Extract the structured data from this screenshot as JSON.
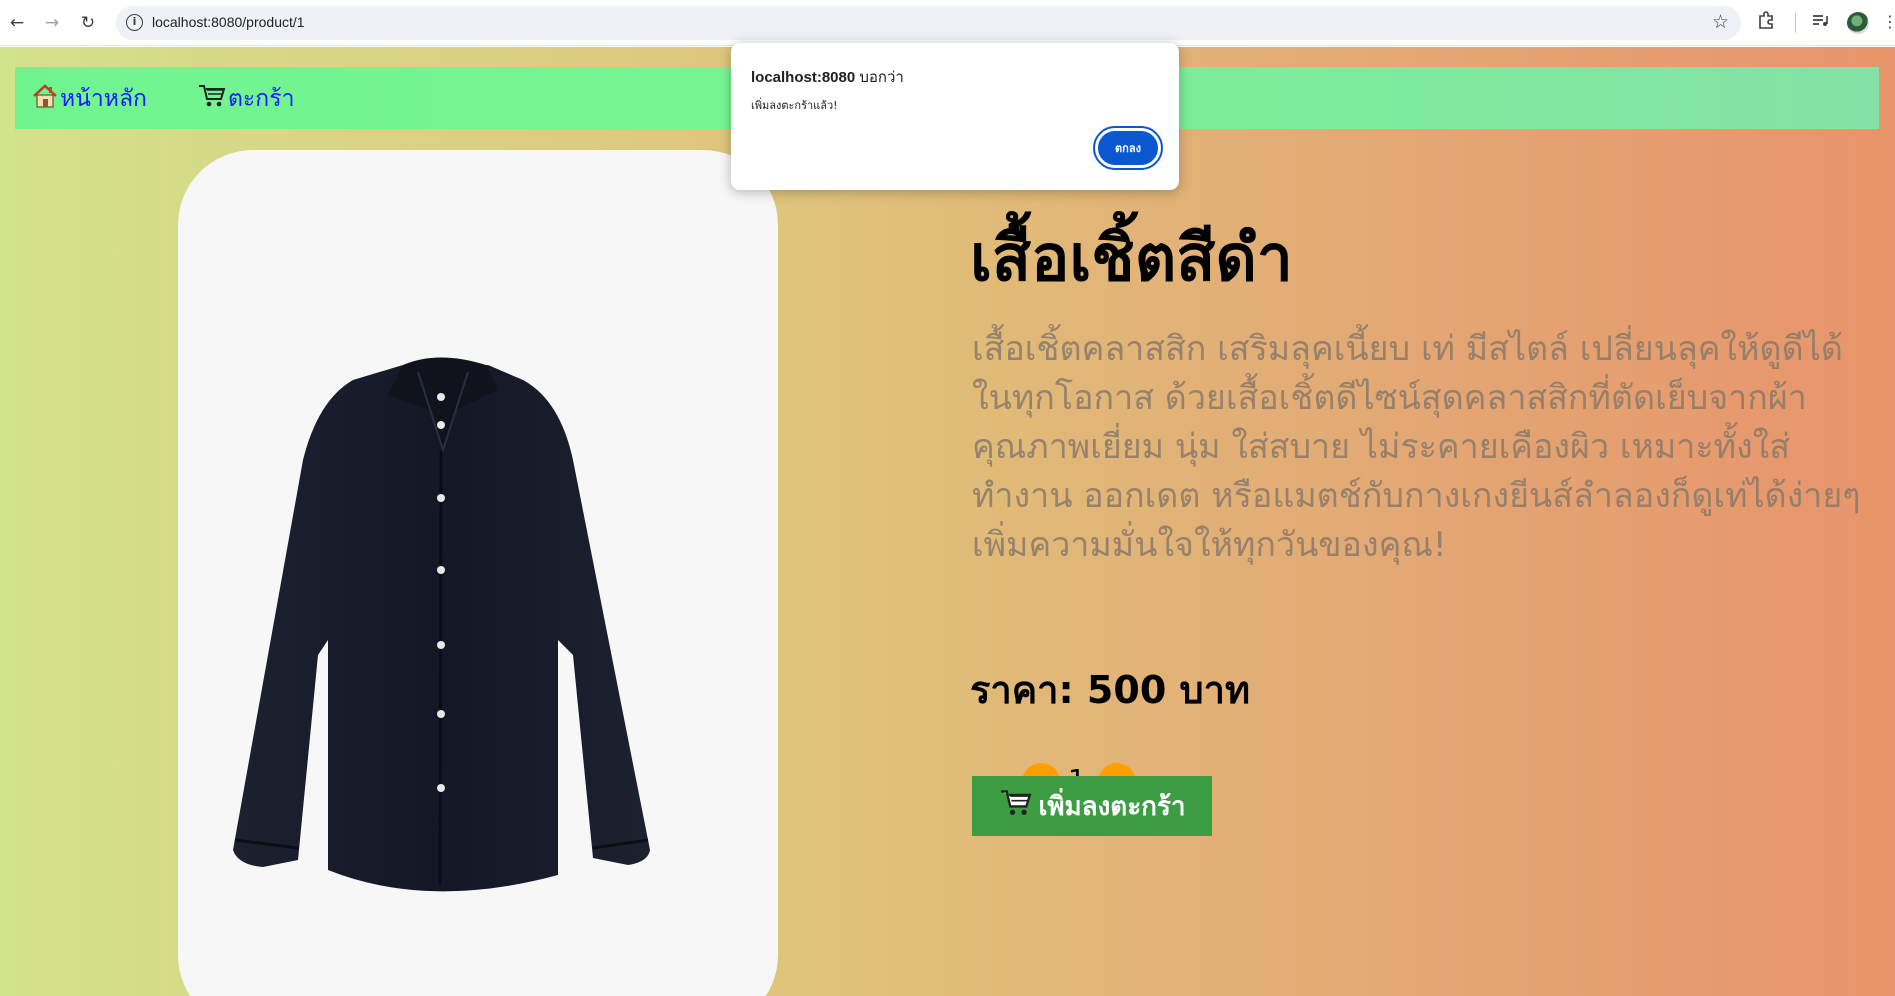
{
  "browser": {
    "url": "localhost:8080/product/1"
  },
  "navbar": {
    "home_icon": "house-icon",
    "home_label": "หน้าหลัก",
    "cart_icon": "shopping-cart-icon",
    "cart_label": "ตะกร้า"
  },
  "product": {
    "image": "black-shirt-image",
    "title": "เสื้อเชิ้ตสีดำ",
    "description": "เสื้อเชิ้ตคลาสสิก เสริมลุคเนี้ยบ เท่ มีสไตล์ เปลี่ยนลุคให้ดูดีได้ในทุกโอกาส ด้วยเสื้อเชิ้ตดีไซน์สุดคลาสสิกที่ตัดเย็บจากผ้าคุณภาพเยี่ยม นุ่ม ใส่สบาย ไม่ระคายเคืองผิว เหมาะทั้งใส่ทำงาน ออกเดต หรือแมตช์กับกางเกงยีนส์ลำลองก็ดูเท่ได้ง่ายๆ เพิ่มความมั่นใจให้ทุกวันของคุณ!",
    "price_label": "ราคา: 500 บาท",
    "quantity": "1",
    "minus_label": "-",
    "plus_label": "+",
    "add_to_cart_label": "เพิ่มลงตะกร้า",
    "add_to_cart_icon": "shopping-cart-icon"
  },
  "dialog": {
    "origin": "localhost:8080",
    "says": "บอกว่า",
    "message": "เพิ่มลงตะกร้าแล้ว!",
    "ok_label": "ตกลง"
  },
  "colors": {
    "navbar": "#78f494",
    "nav_link": "#1a1aff",
    "qty_button": "#ff9e00",
    "add_to_cart": "#3c9d43",
    "dialog_button": "#0b57d0"
  }
}
